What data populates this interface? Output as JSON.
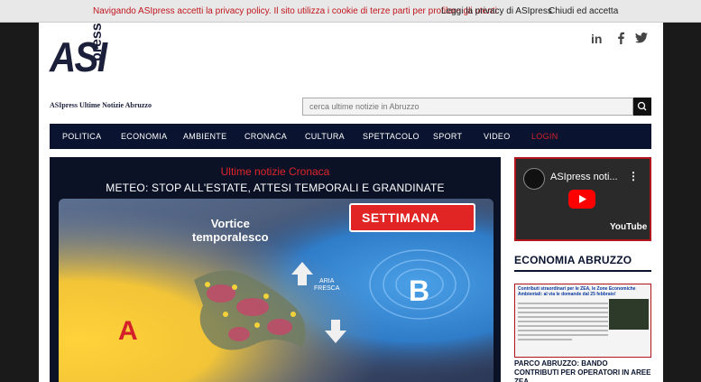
{
  "cookie_bar": {
    "message": "Navigando ASIpress accetti la privacy policy. Il sito utilizza i cookie di terze parti per profilare gli utenti",
    "privacy_link": "Leggi la privacy di ASIpress",
    "accept": "Chiudi ed accetta"
  },
  "header": {
    "logo_main": "ASI",
    "logo_sub": "press",
    "tagline": "ASIpress Ultime Notizie Abruzzo",
    "social": [
      {
        "icon": "linkedin-icon",
        "glyph": "in"
      },
      {
        "icon": "facebook-icon",
        "glyph": "f"
      },
      {
        "icon": "twitter-icon",
        "glyph": "t"
      }
    ]
  },
  "search": {
    "placeholder": "cerca ultime notizie in Abruzzo",
    "icon": "search-icon"
  },
  "nav": [
    {
      "label": "POLITICA"
    },
    {
      "label": "ECONOMIA"
    },
    {
      "label": "AMBIENTE"
    },
    {
      "label": "CRONACA"
    },
    {
      "label": "CULTURA"
    },
    {
      "label": "SPETTACOLO"
    },
    {
      "label": "SPORT"
    },
    {
      "label": "VIDEO"
    },
    {
      "label": "LOGIN"
    }
  ],
  "feature": {
    "section": "Ultime notizie Cronaca",
    "title": "METEO: STOP ALL'ESTATE, ATTESI TEMPORALI E GRANDINATE",
    "image": {
      "vortex_line1": "Vortice",
      "vortex_line2": "temporalesco",
      "badge": "SETTIMANA",
      "air_line1": "ARIA",
      "air_line2": "FRESCA",
      "low": "B",
      "high": "A"
    }
  },
  "video": {
    "title": "ASIpress noti...",
    "more": "⋮",
    "platform": "YouTube"
  },
  "sidebar": {
    "section_title": "ECONOMIA ABRUZZO",
    "card_headline": "Contributi straordinari per le ZEA, le Zone Economiche Ambientali: al via le domande dal 25 febbraio!",
    "caption": "PARCO ABRUZZO: BANDO CONTRIBUTI PER OPERATORI IN AREE ZEA"
  },
  "colors": {
    "brand_navy": "#0a1430",
    "accent_red": "#d4202a",
    "cookie_red": "#c0161e"
  }
}
